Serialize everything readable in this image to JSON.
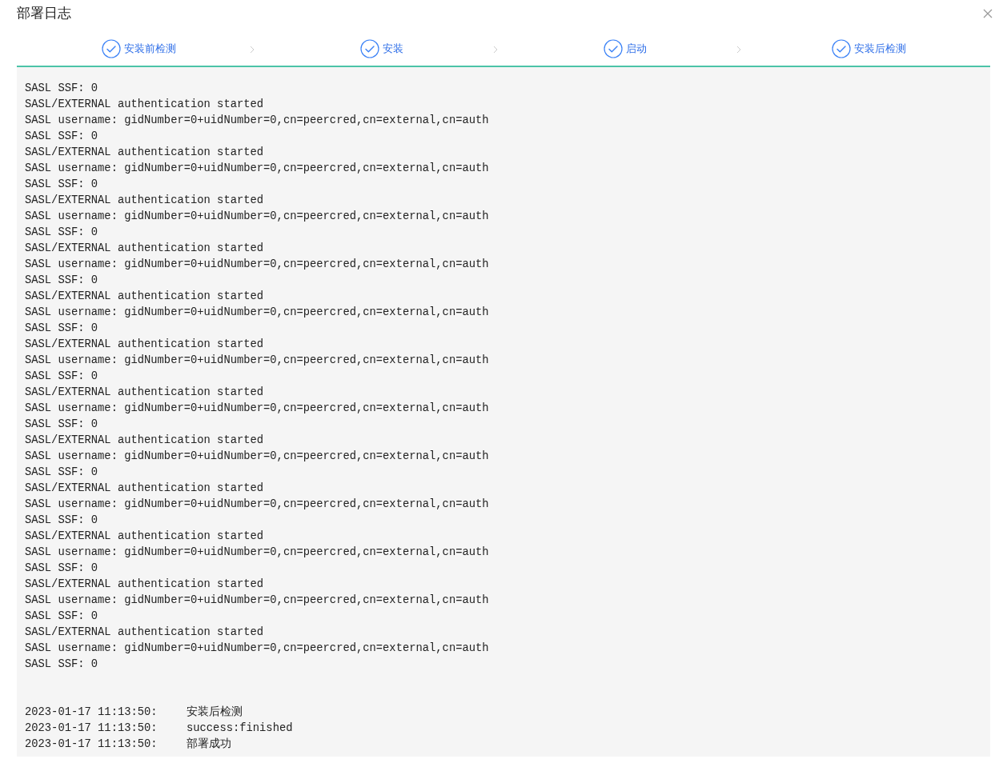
{
  "dialog": {
    "title": "部署日志"
  },
  "steps": [
    {
      "label": "安装前检测",
      "done": true
    },
    {
      "label": "安装",
      "done": true
    },
    {
      "label": "启动",
      "done": true
    },
    {
      "label": "安装后检测",
      "done": true
    }
  ],
  "log": {
    "lines": [
      {
        "kind": "text",
        "text": "SASL SSF: 0"
      },
      {
        "kind": "text",
        "text": "SASL/EXTERNAL authentication started"
      },
      {
        "kind": "text",
        "text": "SASL username: gidNumber=0+uidNumber=0,cn=peercred,cn=external,cn=auth"
      },
      {
        "kind": "text",
        "text": "SASL SSF: 0"
      },
      {
        "kind": "text",
        "text": "SASL/EXTERNAL authentication started"
      },
      {
        "kind": "text",
        "text": "SASL username: gidNumber=0+uidNumber=0,cn=peercred,cn=external,cn=auth"
      },
      {
        "kind": "text",
        "text": "SASL SSF: 0"
      },
      {
        "kind": "text",
        "text": "SASL/EXTERNAL authentication started"
      },
      {
        "kind": "text",
        "text": "SASL username: gidNumber=0+uidNumber=0,cn=peercred,cn=external,cn=auth"
      },
      {
        "kind": "text",
        "text": "SASL SSF: 0"
      },
      {
        "kind": "text",
        "text": "SASL/EXTERNAL authentication started"
      },
      {
        "kind": "text",
        "text": "SASL username: gidNumber=0+uidNumber=0,cn=peercred,cn=external,cn=auth"
      },
      {
        "kind": "text",
        "text": "SASL SSF: 0"
      },
      {
        "kind": "text",
        "text": "SASL/EXTERNAL authentication started"
      },
      {
        "kind": "text",
        "text": "SASL username: gidNumber=0+uidNumber=0,cn=peercred,cn=external,cn=auth"
      },
      {
        "kind": "text",
        "text": "SASL SSF: 0"
      },
      {
        "kind": "text",
        "text": "SASL/EXTERNAL authentication started"
      },
      {
        "kind": "text",
        "text": "SASL username: gidNumber=0+uidNumber=0,cn=peercred,cn=external,cn=auth"
      },
      {
        "kind": "text",
        "text": "SASL SSF: 0"
      },
      {
        "kind": "text",
        "text": "SASL/EXTERNAL authentication started"
      },
      {
        "kind": "text",
        "text": "SASL username: gidNumber=0+uidNumber=0,cn=peercred,cn=external,cn=auth"
      },
      {
        "kind": "text",
        "text": "SASL SSF: 0"
      },
      {
        "kind": "text",
        "text": "SASL/EXTERNAL authentication started"
      },
      {
        "kind": "text",
        "text": "SASL username: gidNumber=0+uidNumber=0,cn=peercred,cn=external,cn=auth"
      },
      {
        "kind": "text",
        "text": "SASL SSF: 0"
      },
      {
        "kind": "text",
        "text": "SASL/EXTERNAL authentication started"
      },
      {
        "kind": "text",
        "text": "SASL username: gidNumber=0+uidNumber=0,cn=peercred,cn=external,cn=auth"
      },
      {
        "kind": "text",
        "text": "SASL SSF: 0"
      },
      {
        "kind": "text",
        "text": "SASL/EXTERNAL authentication started"
      },
      {
        "kind": "text",
        "text": "SASL username: gidNumber=0+uidNumber=0,cn=peercred,cn=external,cn=auth"
      },
      {
        "kind": "text",
        "text": "SASL SSF: 0"
      },
      {
        "kind": "text",
        "text": "SASL/EXTERNAL authentication started"
      },
      {
        "kind": "text",
        "text": "SASL username: gidNumber=0+uidNumber=0,cn=peercred,cn=external,cn=auth"
      },
      {
        "kind": "text",
        "text": "SASL SSF: 0"
      },
      {
        "kind": "text",
        "text": "SASL/EXTERNAL authentication started"
      },
      {
        "kind": "text",
        "text": "SASL username: gidNumber=0+uidNumber=0,cn=peercred,cn=external,cn=auth"
      },
      {
        "kind": "text",
        "text": "SASL SSF: 0"
      },
      {
        "kind": "blank"
      },
      {
        "kind": "blank"
      },
      {
        "kind": "entry",
        "time": "2023-01-17 11:13:50:",
        "text": "安装后检测"
      },
      {
        "kind": "entry",
        "time": "2023-01-17 11:13:50:",
        "text": "success:finished"
      },
      {
        "kind": "entry",
        "time": "2023-01-17 11:13:50:",
        "text": "部署成功"
      }
    ]
  }
}
